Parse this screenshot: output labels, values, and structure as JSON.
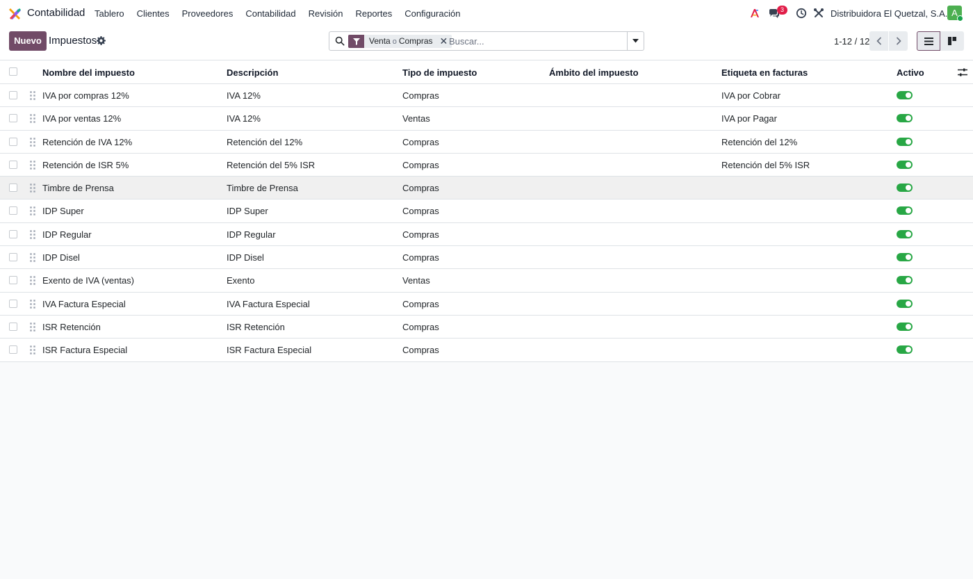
{
  "app": {
    "name": "Contabilidad"
  },
  "nav": {
    "menu": [
      "Tablero",
      "Clientes",
      "Proveedores",
      "Contabilidad",
      "Revisión",
      "Reportes",
      "Configuración"
    ],
    "messages_count": "3",
    "company": "Distribuidora El Quetzal, S.A.",
    "avatar_letter": "A"
  },
  "control": {
    "new_label": "Nuevo",
    "title": "Impuestos",
    "facet_values": [
      "Venta",
      "Compras"
    ],
    "facet_or": "o",
    "search_placeholder": "Buscar...",
    "pager": "1-12 / 12"
  },
  "table": {
    "columns": [
      "Nombre del impuesto",
      "Descripción",
      "Tipo de impuesto",
      "Ámbito del impuesto",
      "Etiqueta en facturas",
      "Activo"
    ],
    "rows": [
      {
        "name": "IVA por compras 12%",
        "description": "IVA 12%",
        "type": "Compras",
        "scope": "",
        "label": "IVA por Cobrar",
        "active": true
      },
      {
        "name": "IVA por ventas 12%",
        "description": "IVA 12%",
        "type": "Ventas",
        "scope": "",
        "label": "IVA por Pagar",
        "active": true
      },
      {
        "name": "Retención de IVA 12%",
        "description": "Retención del 12%",
        "type": "Compras",
        "scope": "",
        "label": "Retención del 12%",
        "active": true
      },
      {
        "name": "Retención de ISR 5%",
        "description": "Retención del 5% ISR",
        "type": "Compras",
        "scope": "",
        "label": "Retención del 5% ISR",
        "active": true
      },
      {
        "name": "Timbre de Prensa",
        "description": "Timbre de Prensa",
        "type": "Compras",
        "scope": "",
        "label": "",
        "active": true
      },
      {
        "name": "IDP Super",
        "description": "IDP Super",
        "type": "Compras",
        "scope": "",
        "label": "",
        "active": true
      },
      {
        "name": "IDP Regular",
        "description": "IDP Regular",
        "type": "Compras",
        "scope": "",
        "label": "",
        "active": true
      },
      {
        "name": "IDP Disel",
        "description": "IDP Disel",
        "type": "Compras",
        "scope": "",
        "label": "",
        "active": true
      },
      {
        "name": "Exento de IVA (ventas)",
        "description": "Exento",
        "type": "Ventas",
        "scope": "",
        "label": "",
        "active": true
      },
      {
        "name": "IVA Factura Especial",
        "description": "IVA Factura Especial",
        "type": "Compras",
        "scope": "",
        "label": "",
        "active": true
      },
      {
        "name": "ISR Retención",
        "description": "ISR Retención",
        "type": "Compras",
        "scope": "",
        "label": "",
        "active": true
      },
      {
        "name": "ISR Factura Especial",
        "description": "ISR Factura Especial",
        "type": "Compras",
        "scope": "",
        "label": "",
        "active": true
      }
    ]
  },
  "colors": {
    "brand": "#714b67",
    "toggle_on": "#28a745",
    "badge": "#e11d48",
    "avatar": "#4caf50"
  },
  "icons": [
    "app-logo-icon",
    "ai-icon",
    "chat-icon",
    "clock-icon",
    "tools-icon",
    "gear-icon",
    "search-icon",
    "filter-icon",
    "close-icon",
    "caret-down-icon",
    "chevron-left-icon",
    "chevron-right-icon",
    "list-view-icon",
    "kanban-view-icon",
    "drag-handle-icon",
    "column-settings-icon"
  ]
}
